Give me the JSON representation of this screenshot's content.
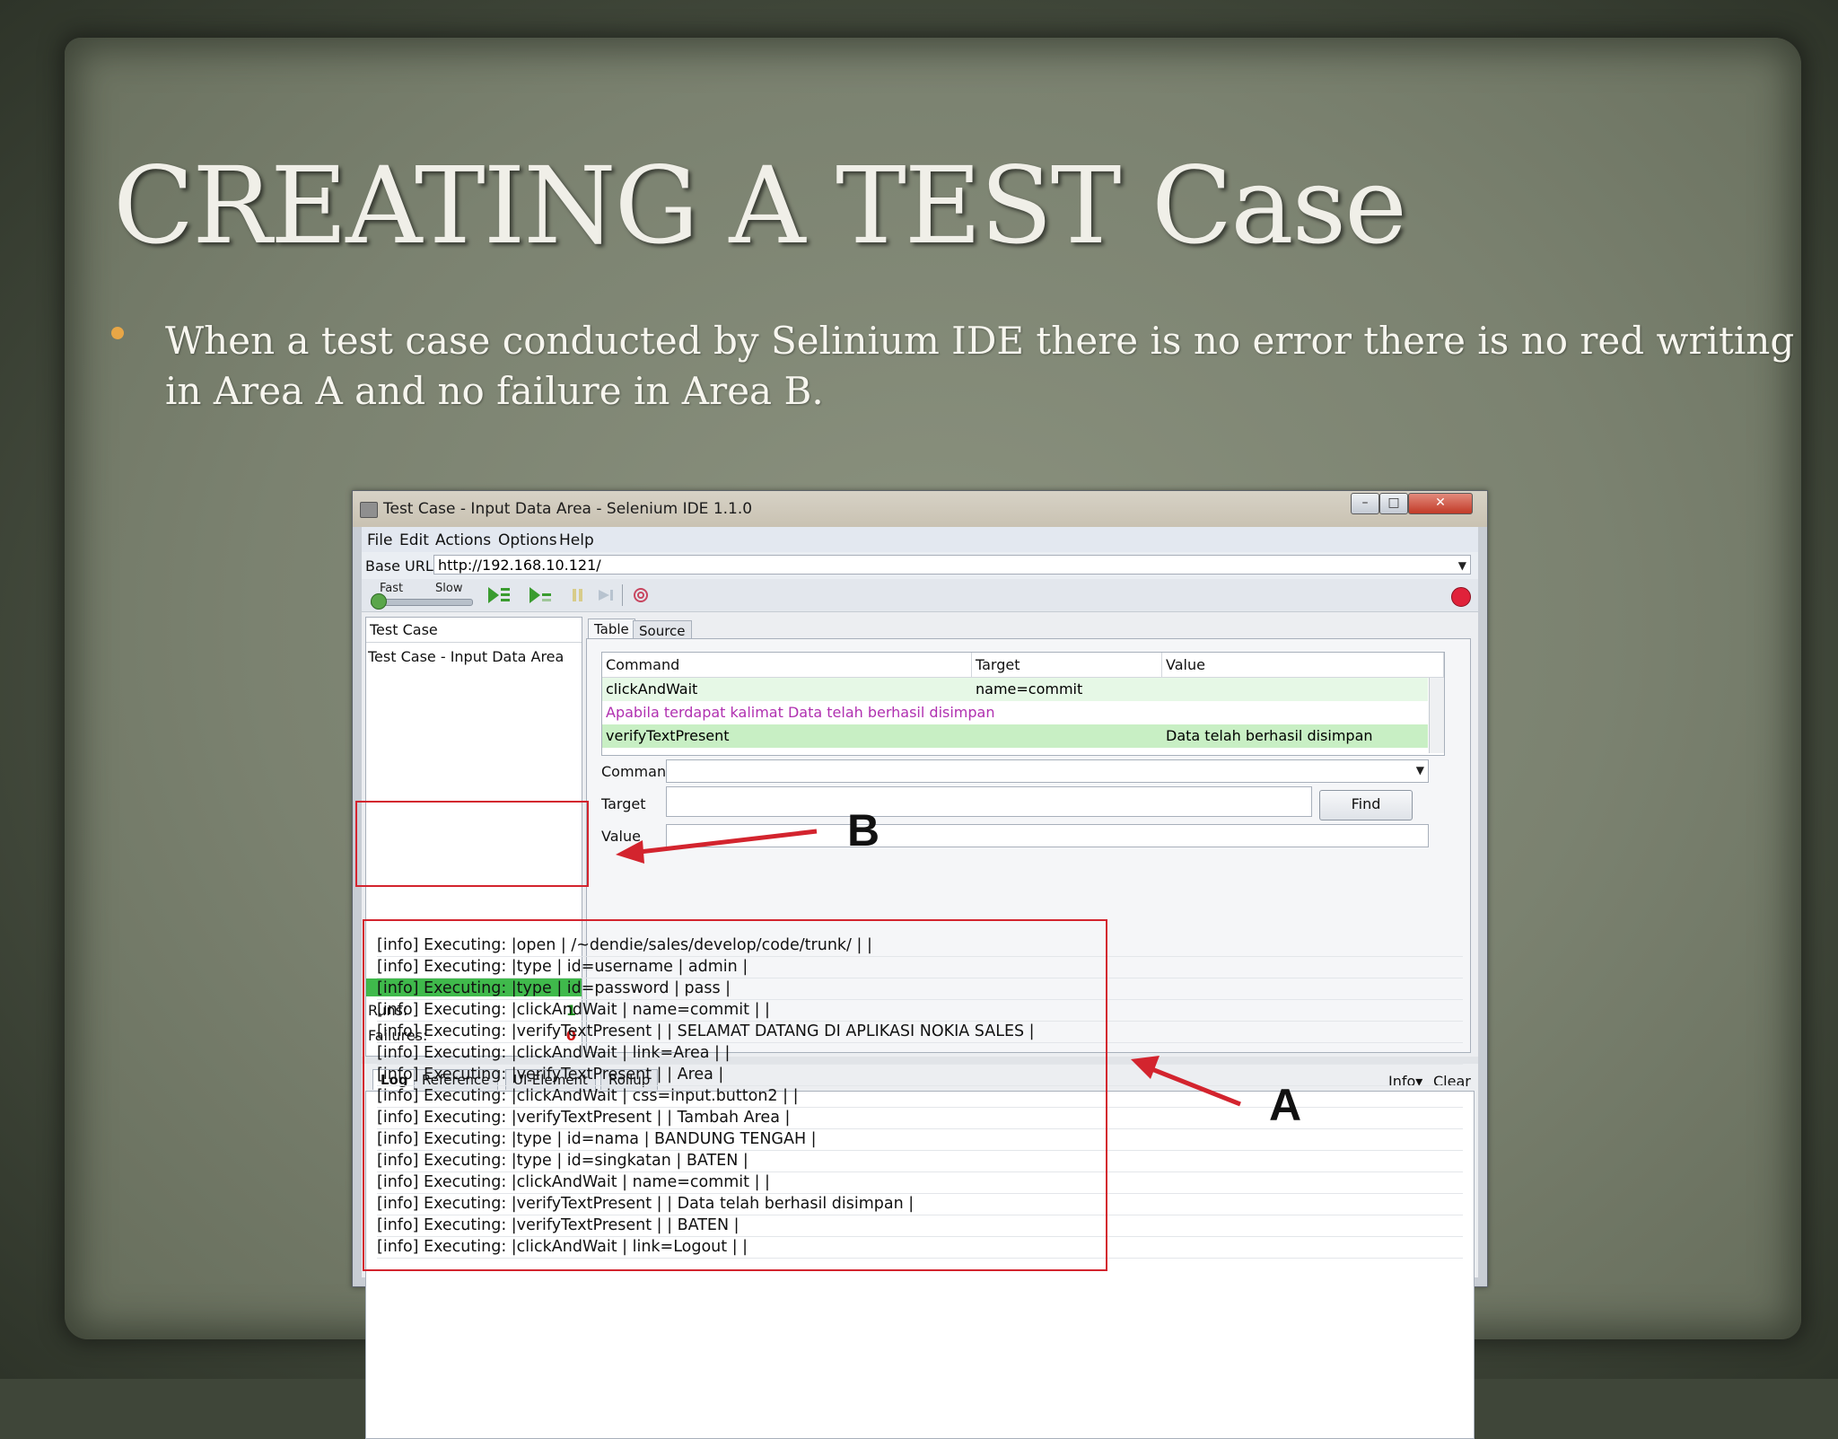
{
  "slide": {
    "title": "CREATING A TEST Case",
    "bullet": "When a test case conducted by Selinium IDE there is no error there is no red writing in Area A and no failure in Area B."
  },
  "window": {
    "title": "Test Case - Input Data Area - Selenium IDE 1.1.0",
    "controls": {
      "minimize": "–",
      "maximize": "□",
      "close": "✕"
    }
  },
  "menu": [
    "File",
    "Edit",
    "Actions",
    "Options",
    "Help"
  ],
  "base_url": {
    "label": "Base URL",
    "value": "http://192.168.10.121/"
  },
  "toolbar": {
    "fast": "Fast",
    "slow": "Slow",
    "icons": [
      "play-all-icon",
      "play-current-icon",
      "pause-icon",
      "step-icon",
      "rollup-icon",
      "record-icon"
    ]
  },
  "test_case_panel": {
    "header": "Test Case",
    "items": [
      "Test Case - Input Data Area"
    ],
    "runs_label": "Runs:",
    "runs": "1",
    "failures_label": "Failures:",
    "failures": "0",
    "progress_fraction": 1.0
  },
  "editor_tabs": [
    "Table",
    "Source"
  ],
  "command_table": {
    "headers": [
      "Command",
      "Target",
      "Value"
    ],
    "rows": [
      {
        "command": "clickAndWait",
        "target": "name=commit",
        "value": ""
      },
      {
        "command": "Apabila terdapat kalimat Data telah berhasil disimpan",
        "target": "",
        "value": ""
      },
      {
        "command": "verifyTextPresent",
        "target": "",
        "value": "Data telah berhasil disimpan"
      }
    ]
  },
  "command_form": {
    "command_label": "Command",
    "target_label": "Target",
    "value_label": "Value",
    "find_label": "Find"
  },
  "log_panel": {
    "tabs": [
      "Log",
      "Reference",
      "UI-Element",
      "Rollup"
    ],
    "info_label": "Info▾",
    "clear_label": "Clear",
    "lines": [
      "[info] Executing: |open | /~dendie/sales/develop/code/trunk/ | |",
      "[info] Executing: |type | id=username | admin |",
      "[info] Executing: |type | id=password | pass |",
      "[info] Executing: |clickAndWait | name=commit | |",
      "[info] Executing: |verifyTextPresent | | SELAMAT DATANG DI APLIKASI NOKIA SALES |",
      "[info] Executing: |clickAndWait | link=Area | |",
      "[info] Executing: |verifyTextPresent | | Area |",
      "[info] Executing: |clickAndWait | css=input.button2 | |",
      "[info] Executing: |verifyTextPresent | | Tambah Area |",
      "[info] Executing: |type | id=nama | BANDUNG TENGAH |",
      "[info] Executing: |type | id=singkatan | BATEN |",
      "[info] Executing: |clickAndWait | name=commit | |",
      "[info] Executing: |verifyTextPresent | | Data telah berhasil disimpan |",
      "[info] Executing: |verifyTextPresent | | BATEN |",
      "[info] Executing: |clickAndWait | link=Logout | |"
    ]
  },
  "annotations": {
    "a": "A",
    "b": "B",
    "color": "#d3242e"
  },
  "colors": {
    "progress": "#3fb94b",
    "runs": "#1a8a1a",
    "failures": "#d01818",
    "bullet": "#e8a646"
  }
}
